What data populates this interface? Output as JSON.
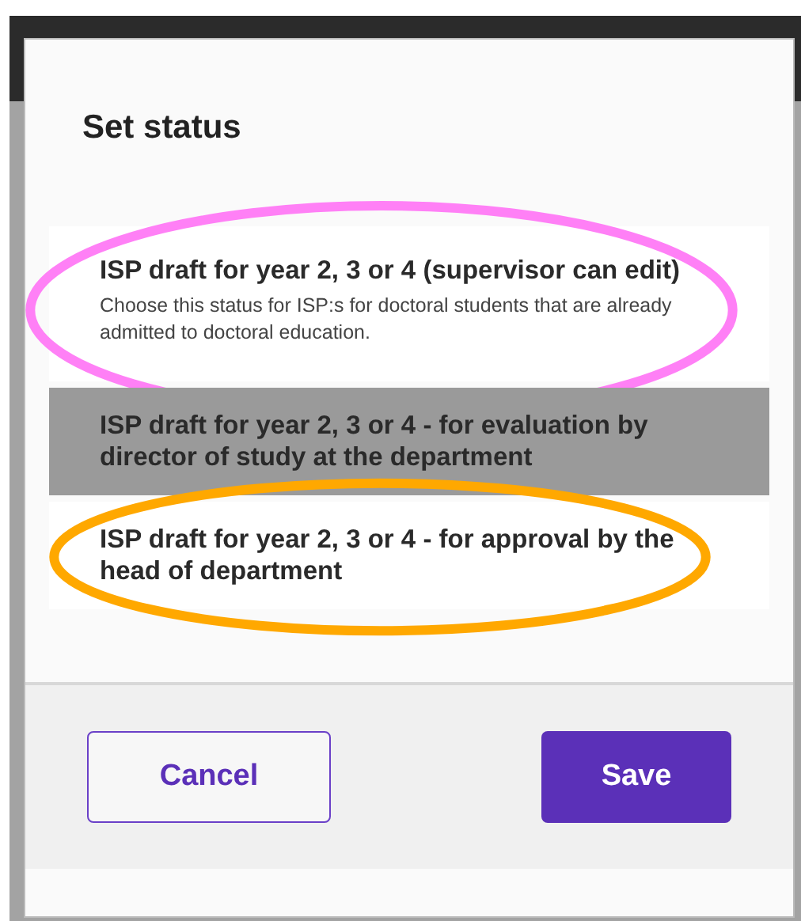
{
  "dialog": {
    "title": "Set status",
    "options": [
      {
        "title": "ISP draft for year 2, 3 or 4 (supervisor can edit)",
        "description": "Choose this status for ISP:s for doctoral students that are already admitted to doctoral education.",
        "selected": false,
        "color": "#ff80f6"
      },
      {
        "title": "ISP draft for year 2, 3 or 4 - for evaluation by director of study at the department",
        "selected": true
      },
      {
        "title": "ISP draft for year 2, 3 or 4 - for approval by the head of department",
        "selected": false,
        "color": "#ffa800"
      }
    ],
    "buttons": [
      {
        "label": "Cancel",
        "kind": "secondary"
      },
      {
        "label": "Save",
        "kind": "primary"
      }
    ]
  }
}
